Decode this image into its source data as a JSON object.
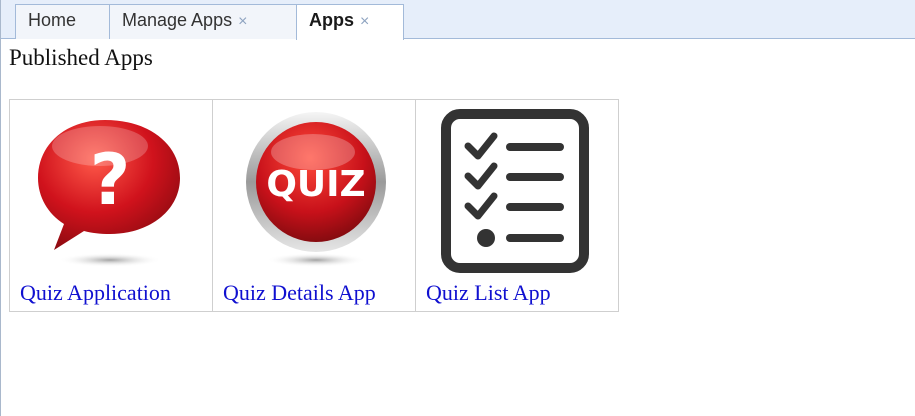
{
  "tabs": [
    {
      "label": "Home",
      "closable": false,
      "active": false
    },
    {
      "label": "Manage Apps",
      "closable": true,
      "active": false
    },
    {
      "label": "Apps",
      "closable": true,
      "active": true
    }
  ],
  "tab_close_glyph": "×",
  "heading": "Published Apps",
  "apps": [
    {
      "label": "Quiz Application",
      "icon": "question-bubble-icon"
    },
    {
      "label": "Quiz Details App",
      "icon": "quiz-button-icon",
      "icon_text": "QUIZ"
    },
    {
      "label": "Quiz List App",
      "icon": "checklist-icon"
    }
  ],
  "colors": {
    "link": "#1010d0",
    "tab_strip": "#e6eefa",
    "icon_red": "#c8111a",
    "icon_dark": "#333333"
  }
}
